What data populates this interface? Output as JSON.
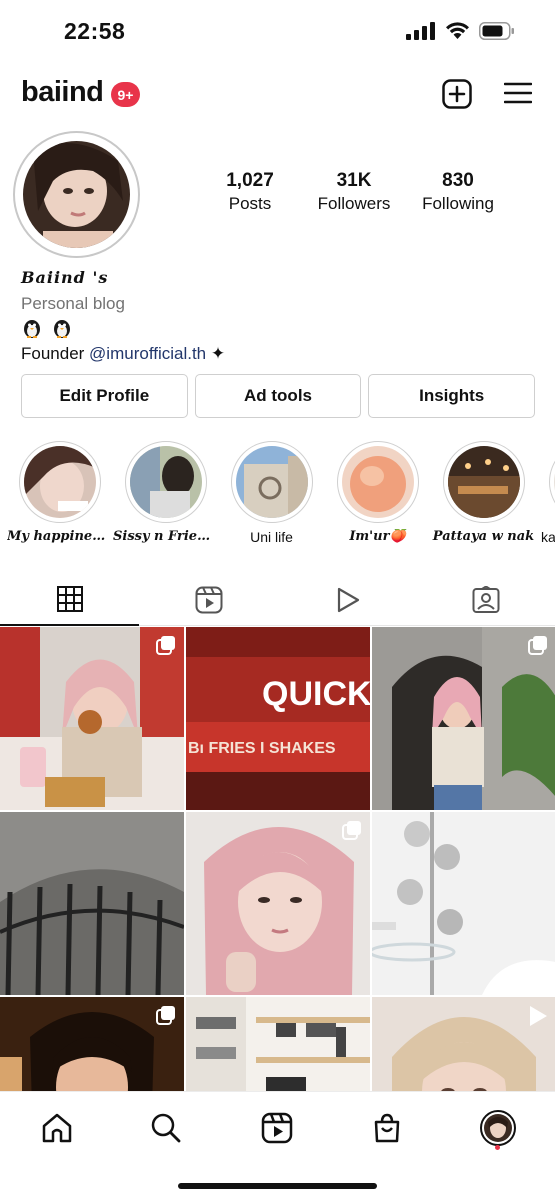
{
  "status_bar": {
    "time": "22:58"
  },
  "header": {
    "username": "baiind",
    "notification_badge": "9+"
  },
  "profile": {
    "stats": [
      {
        "value": "1,027",
        "label": "Posts"
      },
      {
        "value": "31K",
        "label": "Followers"
      },
      {
        "value": "830",
        "label": "Following"
      }
    ],
    "display_name": "Baiind 's",
    "category": "Personal blog",
    "emoji_line": "🐧 🐧",
    "founder_prefix": "Founder ",
    "founder_link": "@imurofficial.th",
    "founder_suffix": " ✦"
  },
  "actions": {
    "edit_profile": "Edit Profile",
    "ad_tools": "Ad tools",
    "insights": "Insights"
  },
  "highlights": [
    {
      "label": "My happines..."
    },
    {
      "label": "Sissy n Friends"
    },
    {
      "label": "Uni life"
    },
    {
      "label": "Im'ur🍑"
    },
    {
      "label": "Pattaya w nak"
    },
    {
      "label": "ka"
    }
  ],
  "tabs": [
    "grid-icon",
    "reels-icon",
    "video-icon",
    "tagged-icon"
  ],
  "grid_posts": [
    {
      "text": ""
    },
    {
      "text": "QUICK",
      "subtext": "Bı FRIES I SHAKES"
    },
    {
      "text": ""
    },
    {
      "text": ""
    },
    {
      "text": ""
    },
    {
      "text": ""
    },
    {
      "text": ""
    },
    {
      "text": ""
    },
    {
      "text": ""
    }
  ],
  "colors": {
    "badge": "#e8344a",
    "link": "#23376b",
    "secondary_text": "#737373"
  }
}
